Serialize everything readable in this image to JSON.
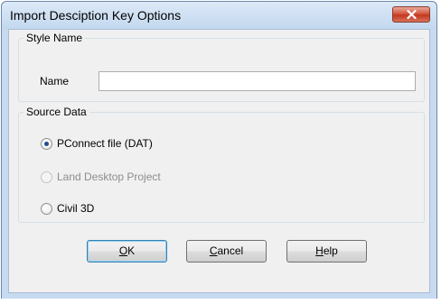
{
  "window": {
    "title": "Import Desciption Key Options"
  },
  "style_group": {
    "legend": "Style Name",
    "name_label": "Name",
    "name_value": ""
  },
  "source_group": {
    "legend": "Source Data",
    "options": [
      {
        "label": "PConnect file (DAT)",
        "checked": true,
        "enabled": true
      },
      {
        "label": "Land Desktop Project",
        "checked": false,
        "enabled": false
      },
      {
        "label": "Civil 3D",
        "checked": false,
        "enabled": true
      }
    ]
  },
  "buttons": {
    "ok": {
      "label": "OK",
      "mnemonic": "O",
      "rest": "K"
    },
    "cancel": {
      "label": "Cancel",
      "mnemonic": "C",
      "rest": "ancel"
    },
    "help": {
      "label": "Help",
      "mnemonic": "H",
      "rest": "elp"
    }
  },
  "colors": {
    "frame": "#c6daf0",
    "close_button": "#c4381f",
    "client": "#f0f0f0",
    "radio_dot": "#1e4f8f"
  },
  "icons": [
    "close-icon"
  ]
}
